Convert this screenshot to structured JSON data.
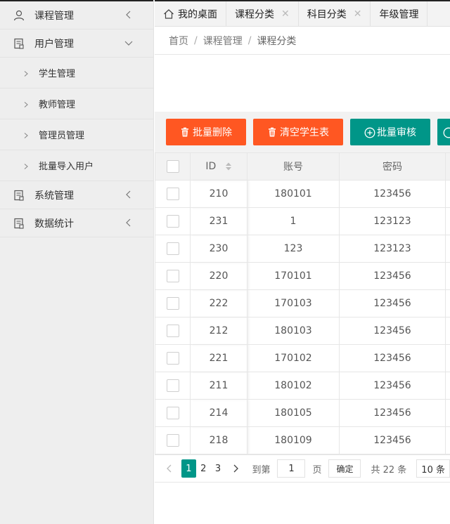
{
  "sidebar": {
    "items": [
      {
        "label": "课程管理",
        "icon": "user-icon",
        "expanded": false
      },
      {
        "label": "用户管理",
        "icon": "document-icon",
        "expanded": true,
        "children": [
          {
            "label": "学生管理"
          },
          {
            "label": "教师管理"
          },
          {
            "label": "管理员管理"
          },
          {
            "label": "批量导入用户"
          }
        ]
      },
      {
        "label": "系统管理",
        "icon": "document-icon",
        "expanded": false
      },
      {
        "label": "数据统计",
        "icon": "document-icon",
        "expanded": false
      }
    ]
  },
  "tabs": [
    {
      "label": "我的桌面",
      "icon": "home-icon",
      "closable": false
    },
    {
      "label": "课程分类",
      "closable": true
    },
    {
      "label": "科目分类",
      "closable": true
    },
    {
      "label": "年级管理",
      "closable": false
    }
  ],
  "breadcrumb": {
    "items": [
      "首页",
      "课程管理",
      "课程分类"
    ],
    "separator": "/"
  },
  "toolbar": {
    "batch_delete": "批量删除",
    "clear_students": "清空学生表",
    "batch_review": "批量审核"
  },
  "table": {
    "headers": {
      "id": "ID",
      "account": "账号",
      "password": "密码"
    },
    "rows": [
      {
        "id": "210",
        "account": "180101",
        "password": "123456"
      },
      {
        "id": "231",
        "account": "1",
        "password": "123123"
      },
      {
        "id": "230",
        "account": "123",
        "password": "123123"
      },
      {
        "id": "220",
        "account": "170101",
        "password": "123456"
      },
      {
        "id": "222",
        "account": "170103",
        "password": "123456"
      },
      {
        "id": "212",
        "account": "180103",
        "password": "123456"
      },
      {
        "id": "221",
        "account": "170102",
        "password": "123456"
      },
      {
        "id": "211",
        "account": "180102",
        "password": "123456"
      },
      {
        "id": "214",
        "account": "180105",
        "password": "123456"
      },
      {
        "id": "218",
        "account": "180109",
        "password": "123456"
      }
    ]
  },
  "pager": {
    "pages": [
      "1",
      "2",
      "3"
    ],
    "current": "1",
    "goto_label": "到第",
    "goto_value": "1",
    "page_unit": "页",
    "confirm": "确定",
    "total": "共 22 条",
    "page_size": "10 条"
  },
  "colors": {
    "danger": "#ff5722",
    "primary": "#009688"
  }
}
